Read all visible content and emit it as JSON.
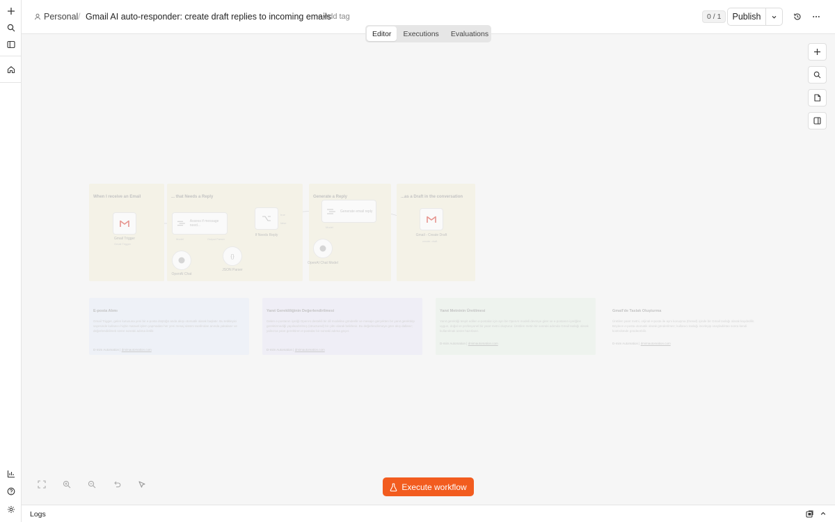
{
  "breadcrumb": {
    "project": "Personal",
    "separator": "/",
    "workflow_title": "Gmail AI auto-responder: create draft replies to incoming emails",
    "add_tag": "+ Add tag"
  },
  "header": {
    "counter": "0 / 1",
    "publish_label": "Publish"
  },
  "tabs": [
    {
      "label": "Editor",
      "active": true
    },
    {
      "label": "Executions",
      "active": false
    },
    {
      "label": "Evaluations",
      "active": false
    }
  ],
  "workflow": {
    "sections": [
      {
        "title": "When I receive an Email"
      },
      {
        "title": "... that Needs a Reply"
      },
      {
        "title": "Generate a Reply"
      },
      {
        "title": "...as a Draft in the conversation"
      }
    ],
    "nodes": {
      "gmail_trigger": {
        "label": "Gmail Trigger",
        "sub": "Gmail Trigger"
      },
      "assess": {
        "text": "Assess if message need..."
      },
      "if_needs_reply": {
        "label": "If Needs Reply"
      },
      "generate_email": {
        "text": "Generate email reply"
      },
      "gmail_draft": {
        "label": "Gmail - Create Draft",
        "sub": "create: draft"
      },
      "openai_chat": {
        "label": "OpenAI Chat"
      },
      "json_parser": {
        "label": "JSON Parser"
      },
      "openai_chat_model": {
        "label": "OpenAI Chat Model"
      }
    },
    "port_labels": {
      "model": "Model",
      "output_parser": "Output Parser",
      "true": "true",
      "false": "false"
    },
    "notes": [
      {
        "title": "E-posta Alımı",
        "body": "Gmail Trigger, gelen kutusuna yeni bir e-posta düştüğü anda akışı otomatik olarak başlatır. Bu tetikleyici sayesinde kullanıcı hiçbir manuel işlem yapmadan her yeni mesaj sistem tarafından anında yakalanır ve değerlendirilmek üzere sonraki adıma iletilir.",
        "footer_prefix": "D-mim Automation |",
        "footer_link": "dmimautomation.com"
      },
      {
        "title": "Yanıt Gerekliliğinin Değerlendirilmesi",
        "body": "Gelen e-postanın içeriği OpenAI destekli bir dil modeline gönderilir ve mesajın gerçekten bir yanıt gerektirip gerektirmediği yapılandırılmış (structured) bir çıktı olarak belirlenir. Bu değerlendirmeye göre akış dallanır; yalnızca yanıt gerektiren e-postalar bir sonraki adıma geçer.",
        "footer_prefix": "D-mim Automation |",
        "footer_link": "dmimautomation.com"
      },
      {
        "title": "Yanıt Metninin Üretilmesi",
        "body": "Yanıt gerektiği tespit edilen e-postalar için ayrı bir OpenAI modeli devreye girer ve e-postanın içeriğine uygun, doğal ve profesyonel bir yanıt metni oluşturur. Üretilen metin bir sonraki adımda Gmail taslağı olarak kullanılmak üzere hazırlanır.",
        "footer_prefix": "D-mim Automation |",
        "footer_link": "dmimautomation.com"
      },
      {
        "title": "Gmail'de Taslak Oluşturma",
        "body": "Üretilen yanıt metni, orijinal e-posta ile aynı konuşma (thread) içinde bir Gmail taslağı olarak kaydedilir. Böylece e-posta otomatik olarak gönderilmez; kullanıcı taslağı inceleyip onayladıktan sonra kendi kontrolünde gönderebilir.",
        "footer_prefix": "D-mim Automation |",
        "footer_link": "dmimautomation.com"
      }
    ]
  },
  "execute_label": "Execute workflow",
  "logs_label": "Logs",
  "colors": {
    "accent": "#f25c1f",
    "sticky_yellow": "#f3f0dc",
    "note_blue": "#e9eef8",
    "note_purple": "#ebe8f6",
    "note_green": "#e8f2e8",
    "gmail_red": "#d9453a"
  },
  "icons": {
    "rail": [
      "plus-icon",
      "search-icon",
      "sidebar-toggle-icon",
      "home-icon",
      "chart-icon",
      "help-icon",
      "settings-icon"
    ],
    "canvas_tools": [
      "plus-icon",
      "search-icon",
      "sticky-note-icon",
      "panel-icon"
    ],
    "zoom_tools": [
      "fit-view-icon",
      "zoom-in-icon",
      "zoom-out-icon",
      "undo-icon",
      "tidy-up-icon"
    ]
  }
}
